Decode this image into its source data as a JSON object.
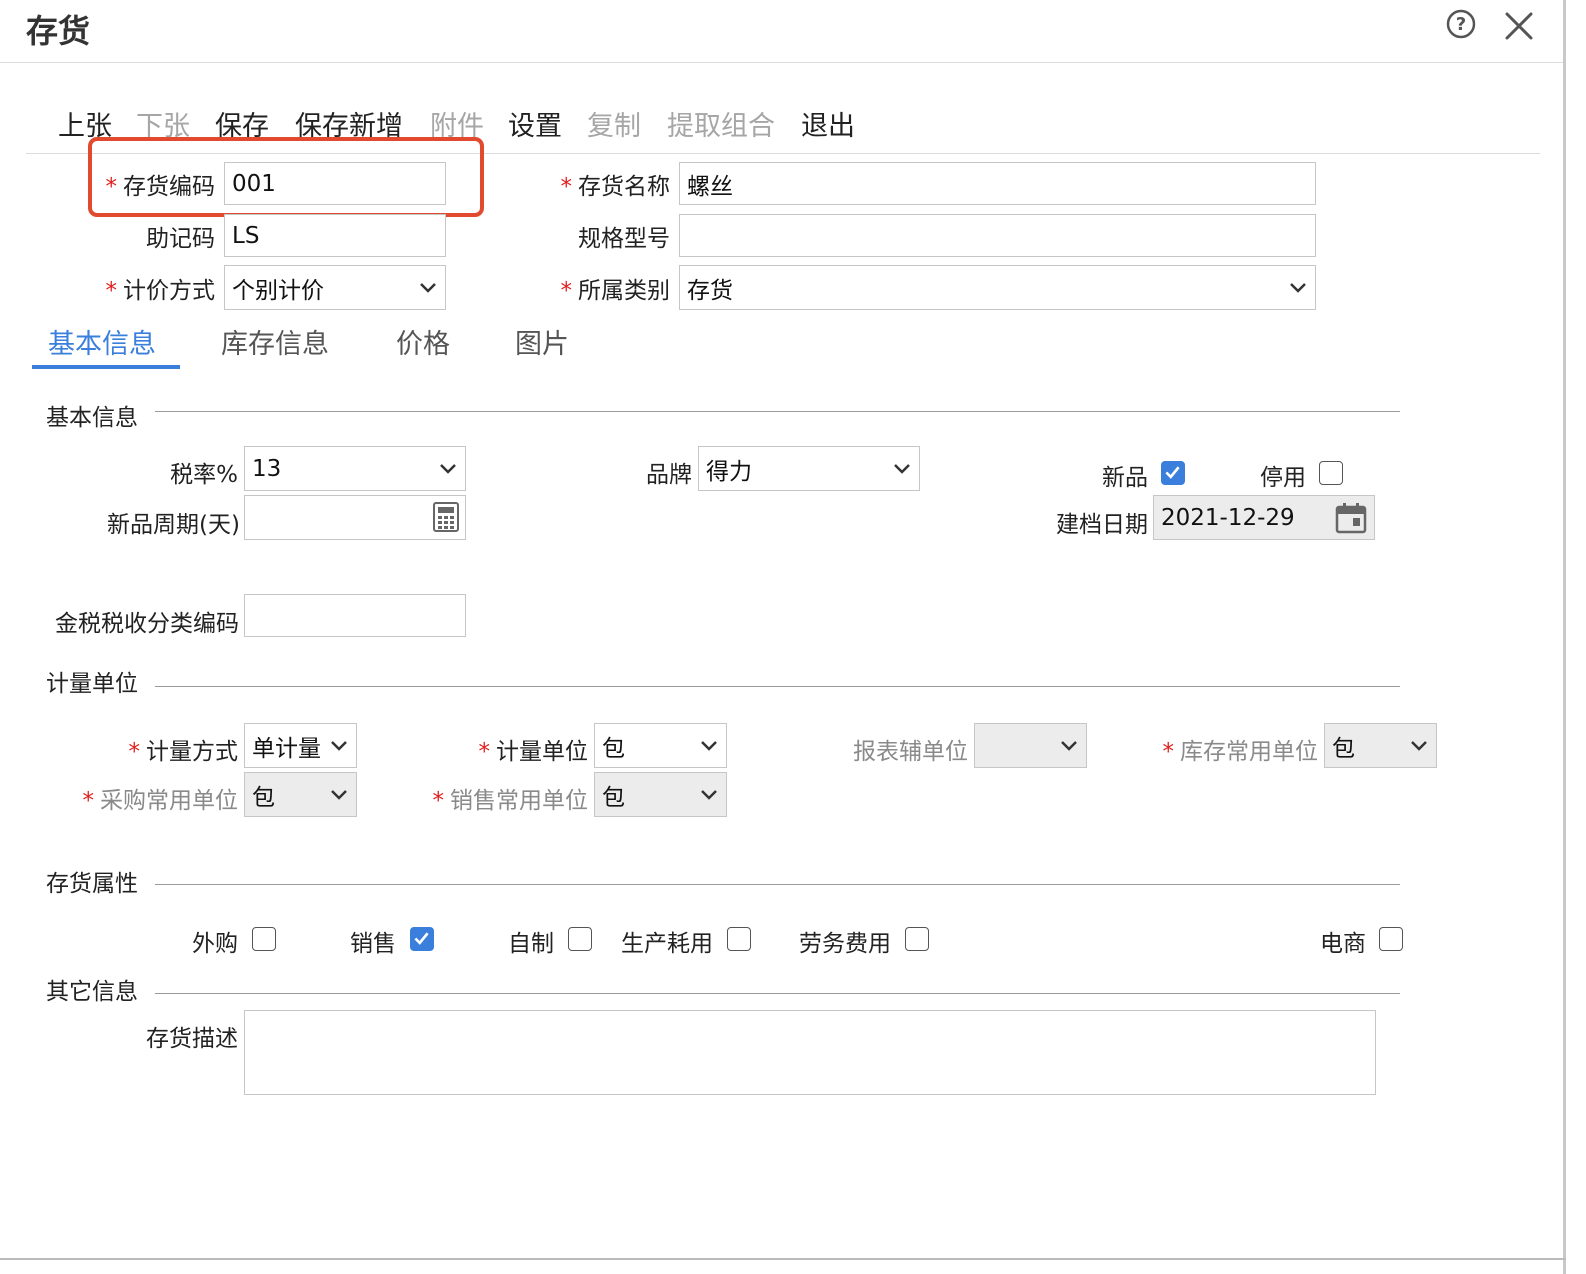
{
  "window": {
    "title": "存货"
  },
  "toolbar": [
    {
      "label": "上张",
      "enabled": true
    },
    {
      "label": "下张",
      "enabled": false
    },
    {
      "label": "保存",
      "enabled": true
    },
    {
      "label": "保存新增",
      "enabled": true
    },
    {
      "label": "附件",
      "enabled": false
    },
    {
      "label": "设置",
      "enabled": true
    },
    {
      "label": "复制",
      "enabled": false
    },
    {
      "label": "提取组合",
      "enabled": false
    },
    {
      "label": "退出",
      "enabled": true
    }
  ],
  "header": {
    "code_label": "存货编码",
    "code_value": "001",
    "name_label": "存货名称",
    "name_value": "螺丝",
    "mnemonic_label": "助记码",
    "mnemonic_value": "LS",
    "spec_label": "规格型号",
    "spec_value": "",
    "pricing_label": "计价方式",
    "pricing_value": "个别计价",
    "category_label": "所属类别",
    "category_value": "存货"
  },
  "tabs": [
    {
      "label": "基本信息",
      "active": true
    },
    {
      "label": "库存信息",
      "active": false
    },
    {
      "label": "价格",
      "active": false
    },
    {
      "label": "图片",
      "active": false
    }
  ],
  "basic": {
    "section": "基本信息",
    "tax_label": "税率%",
    "tax_value": "13",
    "brand_label": "品牌",
    "brand_value": "得力",
    "new_label": "新品",
    "new_checked": true,
    "disabled_label": "停用",
    "disabled_checked": false,
    "cycle_label": "新品周期(天)",
    "cycle_value": "",
    "date_label": "建档日期",
    "date_value": "2021-12-29",
    "taxcode_label": "金税税收分类编码",
    "taxcode_value": ""
  },
  "units": {
    "section": "计量单位",
    "method_label": "计量方式",
    "method_value": "单计量",
    "unit_label": "计量单位",
    "unit_value": "包",
    "report_label": "报表辅单位",
    "report_value": "",
    "stock_label": "库存常用单位",
    "stock_value": "包",
    "purchase_label": "采购常用单位",
    "purchase_value": "包",
    "sales_label": "销售常用单位",
    "sales_value": "包"
  },
  "attrs": {
    "section": "存货属性",
    "items": [
      {
        "label": "外购",
        "checked": false
      },
      {
        "label": "销售",
        "checked": true
      },
      {
        "label": "自制",
        "checked": false
      },
      {
        "label": "生产耗用",
        "checked": false
      },
      {
        "label": "劳务费用",
        "checked": false
      },
      {
        "label": "电商",
        "checked": false
      }
    ]
  },
  "other": {
    "section": "其它信息",
    "desc_label": "存货描述",
    "desc_value": ""
  },
  "colors": {
    "accent": "#3a7fdc",
    "required": "#e02020",
    "highlight": "#e24a30"
  }
}
